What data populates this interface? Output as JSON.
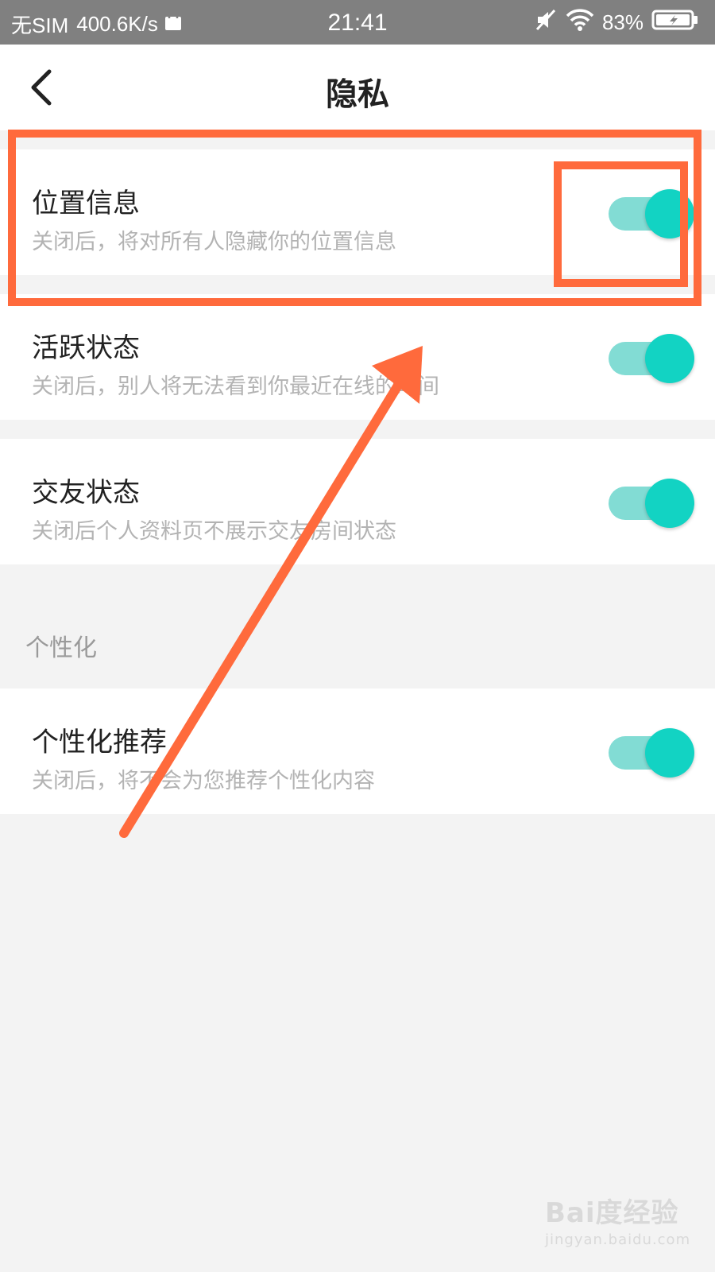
{
  "status_bar": {
    "carrier": "无SIM",
    "speed": "400.6K/s",
    "time": "21:41",
    "battery": "83%",
    "icons": [
      "shopping-bag-icon",
      "mute-icon",
      "wifi-icon",
      "battery-charging-icon"
    ]
  },
  "header": {
    "title": "隐私",
    "back_icon": "chevron-left-icon"
  },
  "settings": [
    {
      "title": "位置信息",
      "description": "关闭后，将对所有人隐藏你的位置信息",
      "enabled": true
    },
    {
      "title": "活跃状态",
      "description": "关闭后，别人将无法看到你最近在线的时间",
      "enabled": true
    },
    {
      "title": "交友状态",
      "description": "关闭后个人资料页不展示交友房间状态",
      "enabled": true
    }
  ],
  "personalization": {
    "section_title": "个性化",
    "items": [
      {
        "title": "个性化推荐",
        "description": "关闭后，将不会为您推荐个性化内容",
        "enabled": true
      }
    ]
  },
  "colors": {
    "toggle_track": "#82dcd4",
    "toggle_knob": "#12d3c3",
    "annotation": "#ff6a3c"
  },
  "watermark": {
    "main": "Bai度经验",
    "sub": "jingyan.baidu.com"
  }
}
